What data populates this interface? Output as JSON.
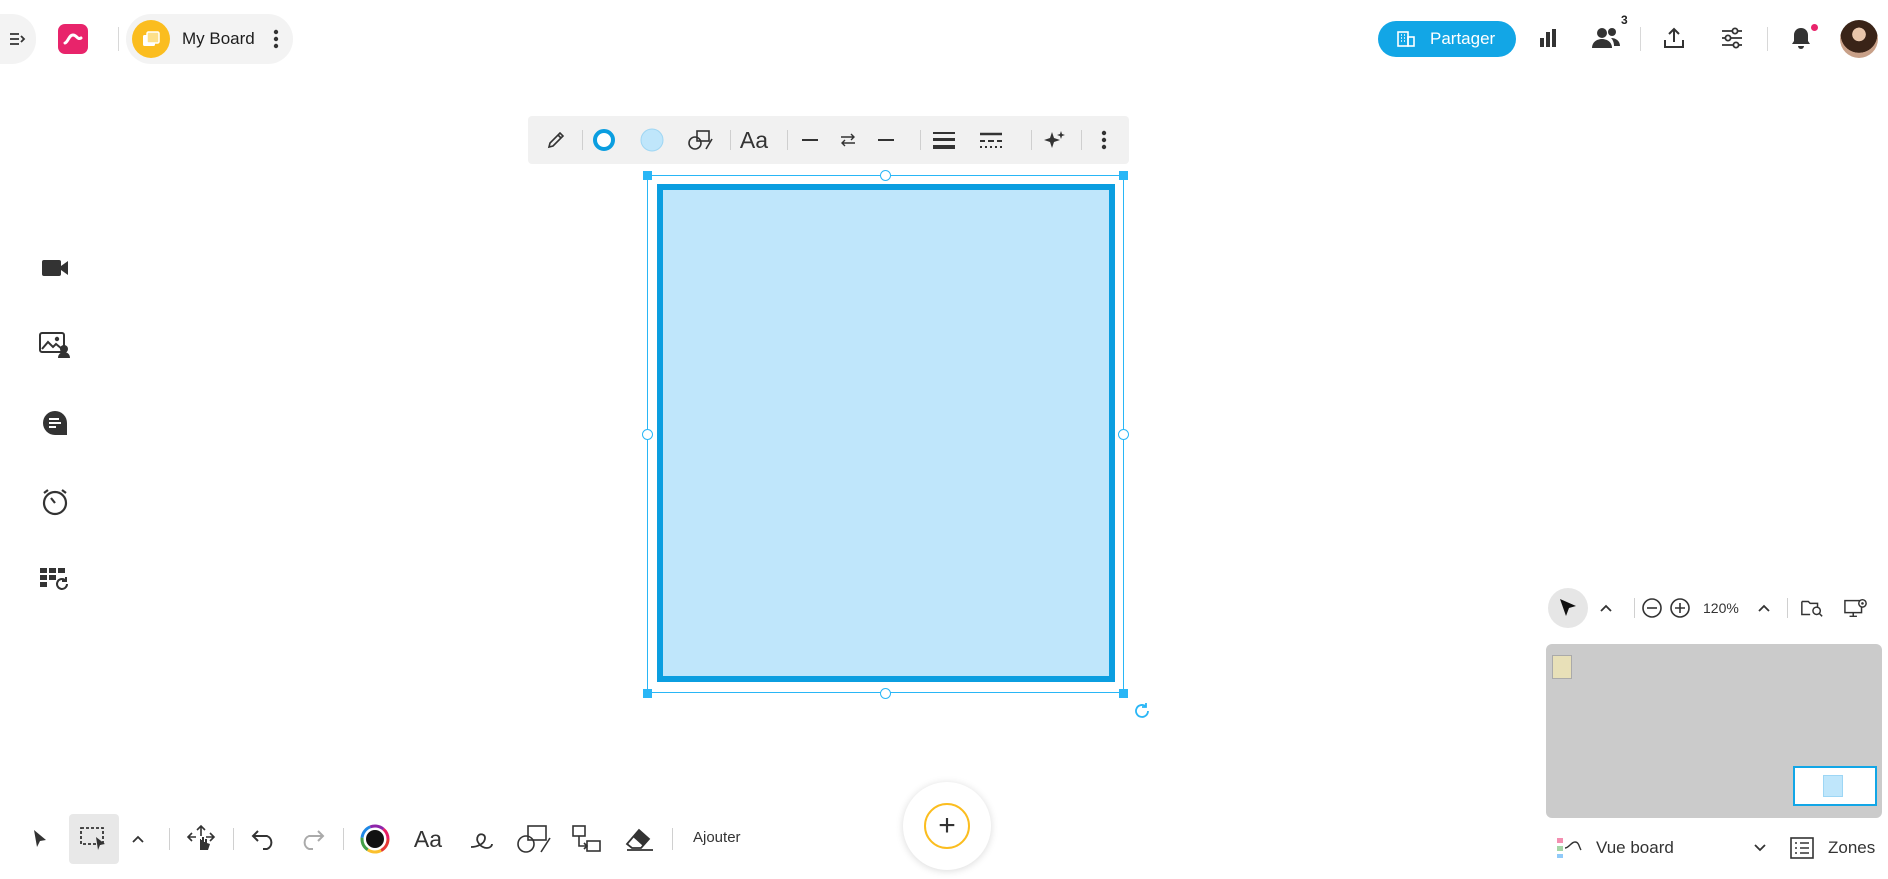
{
  "header": {
    "board_name": "My Board",
    "share_label": "Partager",
    "collaborators_count": "3"
  },
  "shape_toolbar": {
    "font_label": "Aa",
    "stroke_color": "#0b9ee0",
    "fill_color": "#bfe6fb"
  },
  "bottom_toolbar": {
    "text_label": "Aa",
    "add_label": "Ajouter"
  },
  "navigator": {
    "zoom": "120%",
    "view_label": "Vue board",
    "zones_label": "Zones"
  },
  "colors": {
    "accent": "#12a6e6",
    "brand": "#e8246b",
    "board_icon": "#fbbd1f"
  }
}
